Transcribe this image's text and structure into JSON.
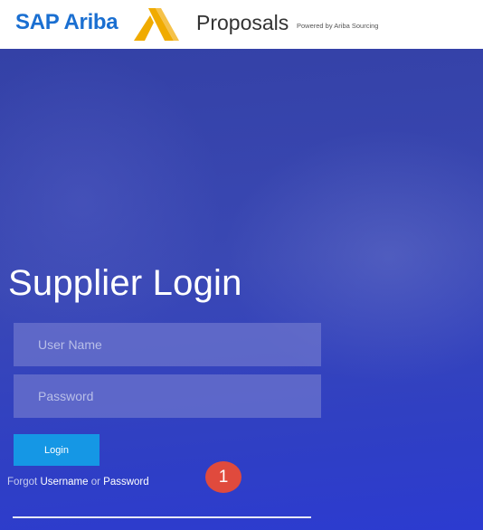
{
  "header": {
    "brand": "SAP Ariba",
    "product": "Proposals",
    "powered_by": "Powered by Ariba Sourcing",
    "logo_colors": [
      "#f0ab00",
      "#f5c24a"
    ]
  },
  "hero": {
    "background_color": "#3441a6"
  },
  "login": {
    "title": "Supplier Login",
    "username_placeholder": "User Name",
    "password_placeholder": "Password",
    "login_button": "Login",
    "forgot_prefix": "Forgot",
    "forgot_username": "Username",
    "forgot_or": "or",
    "forgot_password": "Password",
    "button_color": "#1597e5"
  },
  "annotation": {
    "step_number": "1",
    "color": "#e04a3d"
  }
}
